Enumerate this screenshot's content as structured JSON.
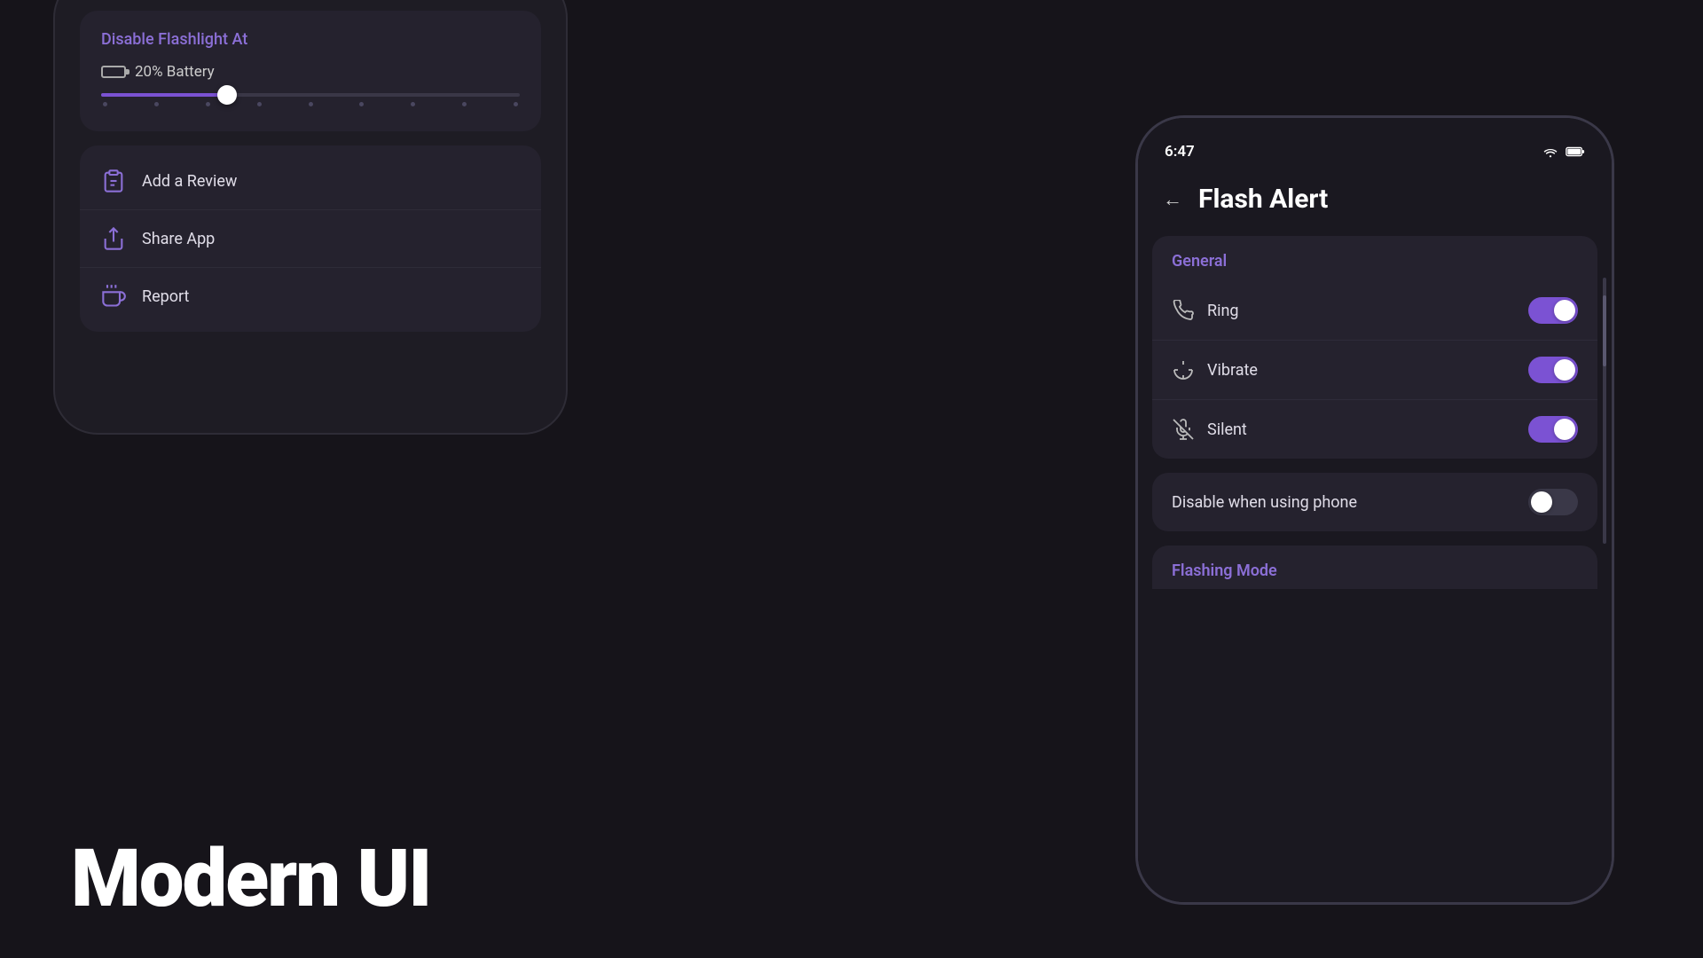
{
  "background": "#16141a",
  "left_phone": {
    "disable_section": {
      "title": "Disable Flashlight At",
      "battery_text": "20% Battery",
      "slider_value": 20
    },
    "menu_items": [
      {
        "id": "add-review",
        "label": "Add a Review",
        "icon": "📋"
      },
      {
        "id": "share-app",
        "label": "Share App",
        "icon": "↗"
      },
      {
        "id": "report",
        "label": "Report",
        "icon": "🔔"
      }
    ]
  },
  "modern_ui_text": "Modern UI",
  "right_phone": {
    "status_bar": {
      "time": "6:47",
      "wifi": "wifi",
      "battery": "🔋"
    },
    "header": {
      "back_label": "←",
      "title": "Flash Alert"
    },
    "general_section": {
      "label": "General",
      "settings": [
        {
          "id": "ring",
          "label": "Ring",
          "icon": "ring",
          "enabled": true
        },
        {
          "id": "vibrate",
          "label": "Vibrate",
          "icon": "vibrate",
          "enabled": true
        },
        {
          "id": "silent",
          "label": "Silent",
          "icon": "silent",
          "enabled": true
        }
      ]
    },
    "disable_phone": {
      "label": "Disable when using phone",
      "enabled": false
    },
    "flashing_section": {
      "label": "Flashing Mode"
    }
  }
}
